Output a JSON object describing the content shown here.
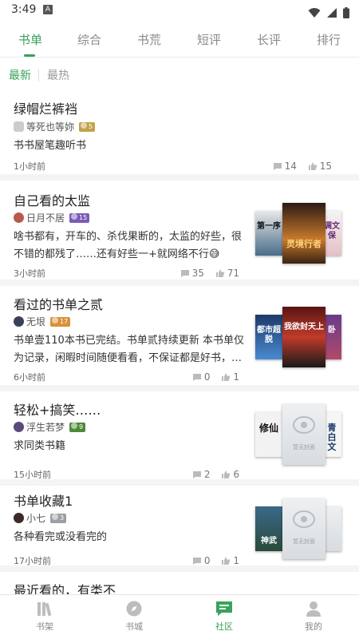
{
  "status_bar": {
    "time": "3:49",
    "notif": "A"
  },
  "top_tabs": [
    {
      "label": "书单",
      "active": true
    },
    {
      "label": "综合"
    },
    {
      "label": "书荒"
    },
    {
      "label": "短评"
    },
    {
      "label": "长评"
    },
    {
      "label": "排行"
    }
  ],
  "sort": {
    "latest": "最新",
    "hottest": "最热"
  },
  "cards": [
    {
      "title": "绿帽烂裤裆",
      "author": "等死也等妳",
      "level": "5",
      "desc": "书书屋笔趣听书",
      "time": "1小时前",
      "comments": "14",
      "likes": "15"
    },
    {
      "title": "自己看的太监",
      "author": "日月不居",
      "level": "15",
      "desc": "啥书都有，开车的、杀伐果断的，太监的好些，很不错的都残了……还有好些一+就网络不行😅",
      "time": "3小时前",
      "comments": "35",
      "likes": "71",
      "covers": [
        "第一序",
        "灵境行者",
        "调文保"
      ]
    },
    {
      "title": "看过的书单之贰",
      "author": "无垠",
      "level": "17",
      "desc": "书单壹110本书已完结。书单贰持续更新 本书单仅为记录，闲暇时间随便看看，不保证都是好书，…",
      "time": "6小时前",
      "comments": "0",
      "likes": "1",
      "covers": [
        "都市超脱",
        "我欲封天上",
        "卧"
      ]
    },
    {
      "title": "轻松+搞笑……",
      "author": "浮生若梦",
      "level": "9",
      "desc": "求同类书籍",
      "time": "15小时前",
      "comments": "2",
      "likes": "6",
      "covers": [
        "修仙",
        "暂无封面",
        "青白文"
      ]
    },
    {
      "title": "书单收藏1",
      "author": "小七",
      "level": "3",
      "desc": "各种看完或没看完的",
      "time": "17小时前",
      "comments": "0",
      "likes": "1",
      "covers": [
        "神武",
        "暂无封面",
        ""
      ]
    },
    {
      "title": "最近看的，有类不"
    }
  ],
  "bottom_nav": [
    {
      "label": "书架"
    },
    {
      "label": "书城"
    },
    {
      "label": "社区",
      "active": true
    },
    {
      "label": "我的"
    }
  ],
  "colors": {
    "accent": "#3aa25a"
  }
}
